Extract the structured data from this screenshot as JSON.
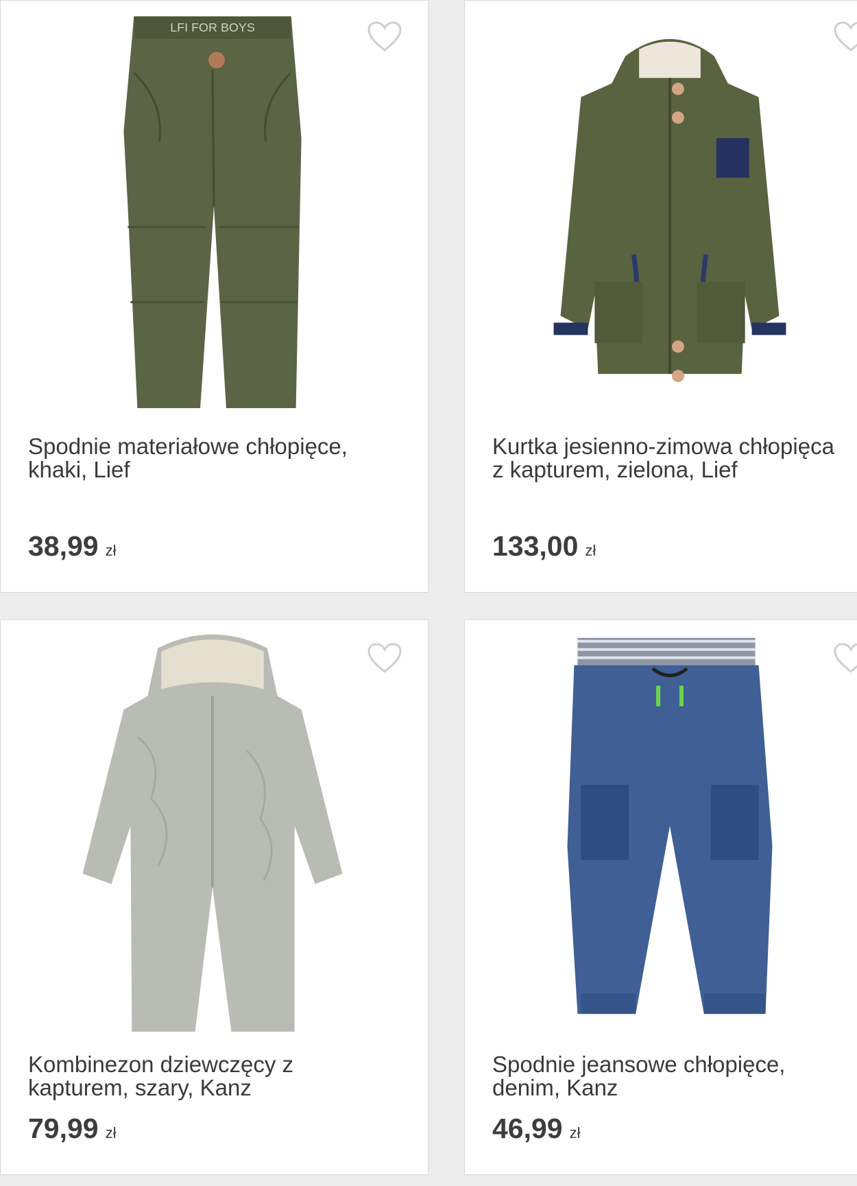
{
  "products": [
    {
      "title_line1": "Spodnie materiałowe chłopięce,",
      "title_line2": "khaki, Lief",
      "price": "38,99",
      "currency": "zł",
      "image_icon": "khaki-trousers-image",
      "image_color": "#5b6445",
      "favorite_icon": "heart-outline-icon"
    },
    {
      "title_line1": "Kurtka jesienno-zimowa chłopięca",
      "title_line2": "z kapturem, zielona, Lief",
      "price": "133,00",
      "currency": "zł",
      "image_icon": "green-parka-jacket-image",
      "image_color": "#5a6340",
      "favorite_icon": "heart-outline-icon"
    },
    {
      "title_line1": "Kombinezon dziewczęcy z",
      "title_line2": "kapturem, szary, Kanz",
      "price": "79,99",
      "currency": "zł",
      "image_icon": "grey-hooded-jumpsuit-image",
      "image_color": "#b9bcb5",
      "favorite_icon": "heart-outline-icon"
    },
    {
      "title_line1": "Spodnie jeansowe chłopięce,",
      "title_line2": "denim, Kanz",
      "price": "46,99",
      "currency": "zł",
      "image_icon": "denim-cargo-jeans-image",
      "image_color": "#3f5f95",
      "favorite_icon": "heart-outline-icon"
    }
  ]
}
